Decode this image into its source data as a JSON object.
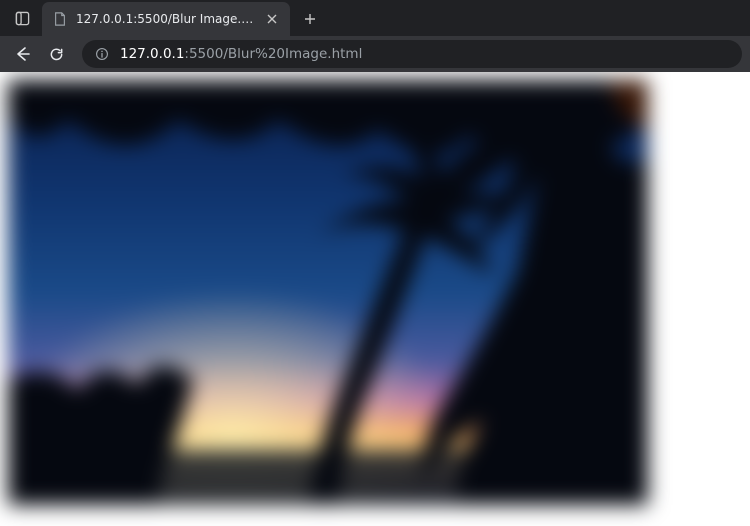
{
  "browser": {
    "tab": {
      "title": "127.0.0.1:5500/Blur Image.html",
      "favicon": "file-icon"
    },
    "url": {
      "host": "127.0.0.1",
      "port_path": ":5500/Blur%20Image.html"
    },
    "buttons": {
      "tab_actions": "tab-actions",
      "close_tab": "×",
      "new_tab": "+",
      "back": "←",
      "refresh": "⟳"
    }
  },
  "page": {
    "image_alt": "blurred tropical sunset with palm tree silhouettes"
  }
}
